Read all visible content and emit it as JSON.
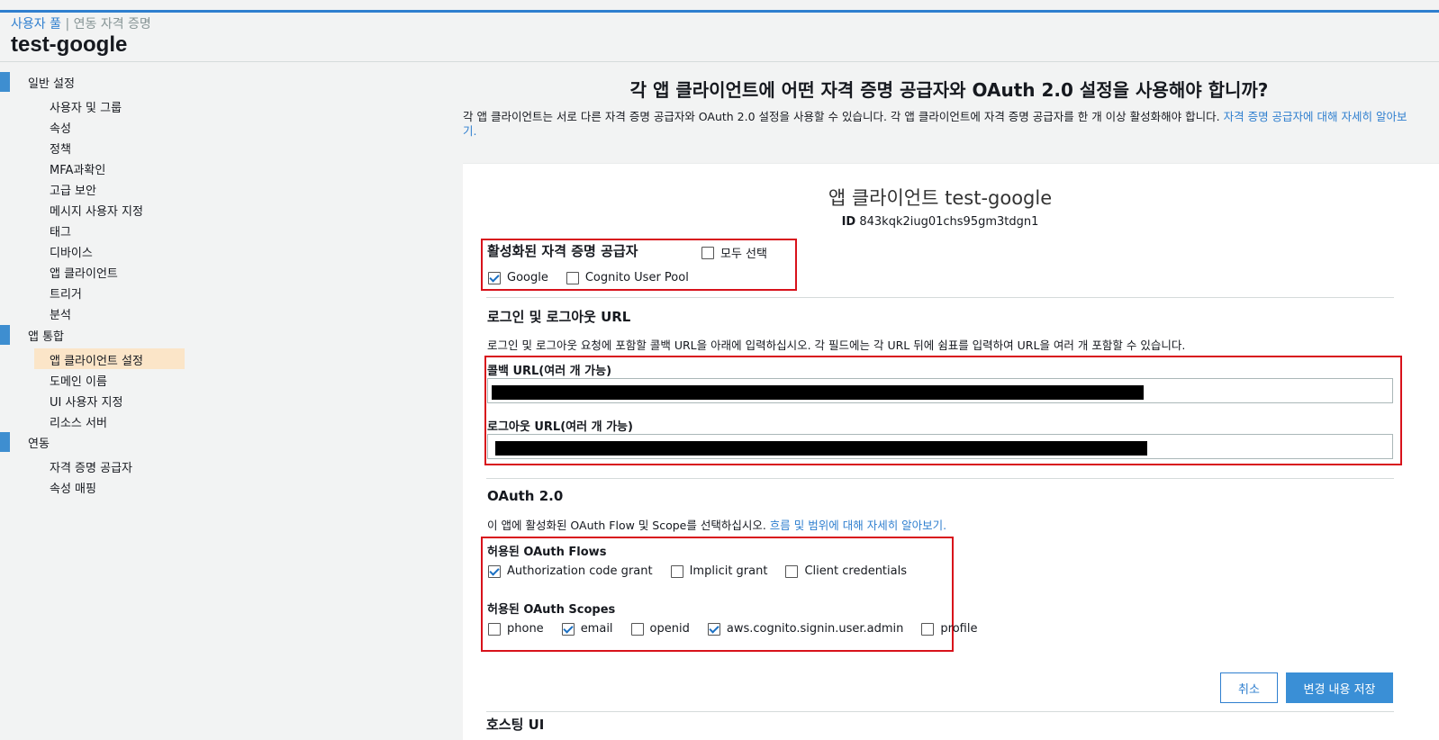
{
  "breadcrumb": {
    "user_pool": "사용자 풀",
    "separator": "|",
    "federated": "연동 자격 증명"
  },
  "page_title": "test-google",
  "sidebar": {
    "general": {
      "label": "일반 설정",
      "items": [
        "사용자 및 그룹",
        "속성",
        "정책",
        "MFA과확인",
        "고급 보안",
        "메시지 사용자 지정",
        "태그",
        "디바이스",
        "앱 클라이언트",
        "트리거",
        "분석"
      ]
    },
    "app_integration": {
      "label": "앱 통합",
      "items": [
        "앱 클라이언트 설정",
        "도메인 이름",
        "UI 사용자 지정",
        "리소스 서버"
      ],
      "active_index": 0
    },
    "federation": {
      "label": "연동",
      "items": [
        "자격 증명 공급자",
        "속성 매핑"
      ]
    }
  },
  "main": {
    "heading": "각 앱 클라이언트에 어떤 자격 증명 공급자와 OAuth 2.0 설정을 사용해야 합니까?",
    "intro_text": "각 앱 클라이언트는 서로 다른 자격 증명 공급자와 OAuth 2.0 설정을 사용할 수 있습니다. 각 앱 클라이언트에 자격 증명 공급자를 한 개 이상 활성화해야 합니다. ",
    "intro_link": "자격 증명 공급자에 대해 자세히 알아보기."
  },
  "card": {
    "title": "앱 클라이언트 test-google",
    "id_label": "ID",
    "id_value": "843kqk2iug01chs95gm3tdgn1",
    "providers": {
      "heading": "활성화된 자격 증명 공급자",
      "select_all": {
        "label": "모두 선택",
        "checked": false
      },
      "options": [
        {
          "label": "Google",
          "checked": true
        },
        {
          "label": "Cognito User Pool",
          "checked": false
        }
      ]
    },
    "urls": {
      "heading": "로그인 및 로그아웃 URL",
      "description": "로그인 및 로그아웃 요청에 포함할 콜백 URL을 아래에 입력하십시오. 각 필드에는 각 URL 뒤에 쉼표를 입력하여 URL을 여러 개 포함할 수 있습니다.",
      "callback_label": "콜백 URL(여러 개 가능)",
      "logout_label": "로그아웃 URL(여러 개 가능)"
    },
    "oauth": {
      "heading": "OAuth 2.0",
      "description": "이 앱에 활성화된 OAuth Flow 및 Scope를 선택하십시오. ",
      "link": "흐름 및 범위에 대해 자세히 알아보기.",
      "flows_label": "허용된 OAuth Flows",
      "flows": [
        {
          "label": "Authorization code grant",
          "checked": true
        },
        {
          "label": "Implicit grant",
          "checked": false
        },
        {
          "label": "Client credentials",
          "checked": false
        }
      ],
      "scopes_label": "허용된 OAuth Scopes",
      "scopes": [
        {
          "label": "phone",
          "checked": false
        },
        {
          "label": "email",
          "checked": true
        },
        {
          "label": "openid",
          "checked": false
        },
        {
          "label": "aws.cognito.signin.user.admin",
          "checked": true
        },
        {
          "label": "profile",
          "checked": false
        }
      ]
    },
    "buttons": {
      "cancel": "취소",
      "save": "변경 내용 저장"
    },
    "partial_heading": "호스팅 UI"
  },
  "colors": {
    "accent": "#2f7fcf",
    "highlight": "#fbe5c8",
    "annotation": "#d8121b"
  }
}
